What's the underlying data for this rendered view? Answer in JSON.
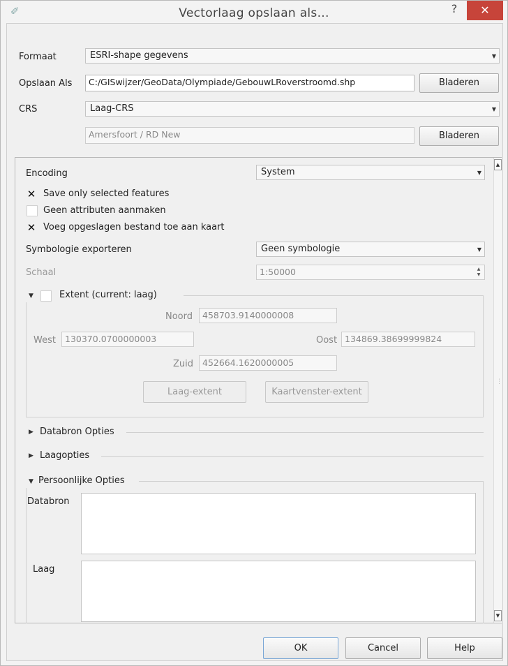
{
  "window": {
    "title": "Vectorlaag opslaan als...",
    "help_glyph": "?",
    "close_glyph": "✕"
  },
  "form": {
    "format_label": "Formaat",
    "format_value": "ESRI-shape gegevens",
    "save_as_label": "Opslaan Als",
    "save_as_path": "C:/GISwijzer/GeoData/Olympiade/GebouwLRoverstroomd.shp",
    "browse_label": "Bladeren",
    "crs_label": "CRS",
    "crs_value": "Laag-CRS",
    "crs_name": "Amersfoort / RD New",
    "crs_browse_label": "Bladeren"
  },
  "options": {
    "encoding_label": "Encoding",
    "encoding_value": "System",
    "save_selected_label": "Save only selected features",
    "save_selected_checked": "✕",
    "no_attributes_label": "Geen attributen aanmaken",
    "add_to_map_label": "Voeg opgeslagen bestand toe aan kaart",
    "add_to_map_checked": "✕",
    "symbology_label": "Symbologie exporteren",
    "symbology_value": "Geen symbologie",
    "scale_label": "Schaal",
    "scale_value": "1:50000"
  },
  "extent": {
    "title": "Extent (current: laag)",
    "north_label": "Noord",
    "north_value": "458703.9140000008",
    "west_label": "West",
    "west_value": "130370.0700000003",
    "east_label": "Oost",
    "east_value": "134869.38699999824",
    "south_label": "Zuid",
    "south_value": "452664.1620000005",
    "layer_extent_button": "Laag-extent",
    "canvas_extent_button": "Kaartvenster-extent"
  },
  "sections": {
    "datasource_options": "Databron Opties",
    "layer_options": "Laagopties",
    "custom_options": "Persoonlijke Opties",
    "datasource_label": "Databron",
    "layer_label": "Laag"
  },
  "buttons": {
    "ok": "OK",
    "cancel": "Cancel",
    "help": "Help"
  }
}
